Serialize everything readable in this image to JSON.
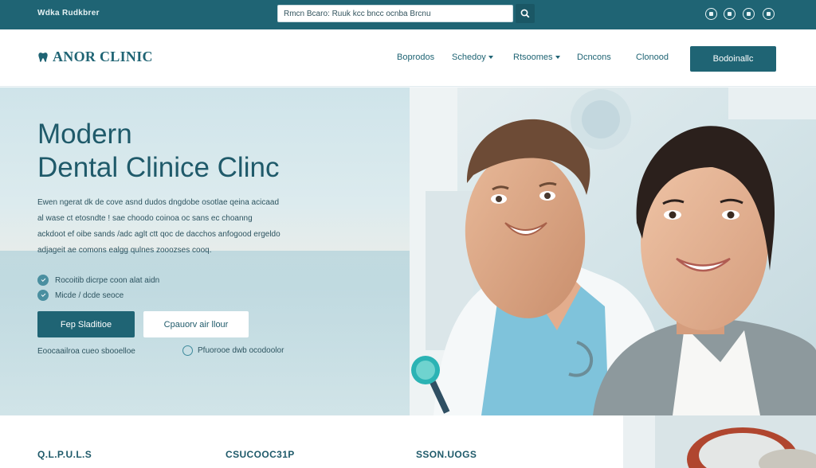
{
  "topbar": {
    "brand": "Wdka Rudkbrer",
    "search": {
      "value": "Rmcn Bcaro: Ruuk kcc bncc ocnba Brcnu"
    },
    "social_icons": [
      "facebook-icon",
      "instagram-icon",
      "twitter-icon",
      "youtube-icon"
    ]
  },
  "header": {
    "logo": "ANOR CLINIC",
    "nav": [
      {
        "label": "Boprodos",
        "has_caret": false
      },
      {
        "label": "Schedoy",
        "has_caret": true
      },
      {
        "label": "Rtsoomes",
        "has_caret": true
      },
      {
        "label": "Dcncons",
        "has_caret": false
      },
      {
        "label": "Clonood",
        "has_caret": false
      }
    ],
    "book_label": "Bodoinallc"
  },
  "hero": {
    "title_line1": "Modern",
    "title_line2": "Dental Clinice Clinc",
    "desc": [
      "Ewen ngerat dk de cove asnd dudos dngdobe osotlae qeina acicaad",
      "al wase ct etosndte ! sae choodo coinoa oc sans ec choanng",
      "ackdoot ef oibe sands /adc aglt ctt qoc de dacchos anfogood ergeldo",
      "adjageit ae comons ealgg qulnes zooozses cooq."
    ],
    "features": [
      "Rocoitib dicrpe coon alat aidn",
      "Micde / dcde seoce"
    ],
    "cta_primary": "Fep Sladitioe",
    "cta_secondary": "Cpauorv air llour",
    "footnote": "Eoocaailroa cueo sbooelloe",
    "footnote2": "Pfuorooe dwb ocodoolor"
  },
  "bottom": {
    "headings": [
      "Q.L.P.U.L.S",
      "CSUCOOC31P",
      "SSON.UOGS"
    ]
  },
  "colors": {
    "primary": "#1f6474",
    "topbar": "#1f6474",
    "text": "#1f5a6a"
  }
}
